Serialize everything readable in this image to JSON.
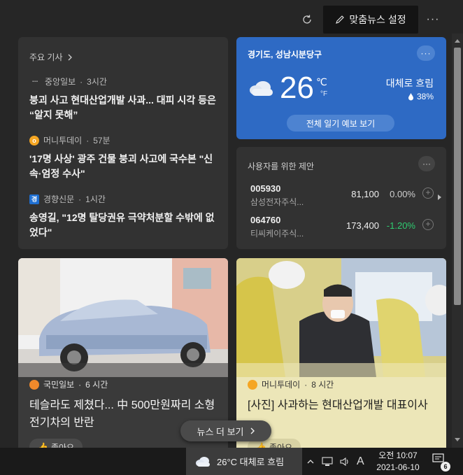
{
  "toolbar": {
    "refresh_icon": "refresh-icon",
    "personalize_label": "맞춤뉴스 설정",
    "more_label": "···"
  },
  "top_stories": {
    "header": "주요 기사",
    "items": [
      {
        "source": "중앙일보",
        "time": "3시간",
        "title": "붕괴 사고 현대산업개발 사과... 대피 시각 등은 “알지 못해”"
      },
      {
        "source": "머니투데이",
        "time": "57분",
        "title": "'17명 사상' 광주 건물 붕괴 사고에 국수본 \"신속·엄정 수사\""
      },
      {
        "source": "경향신문",
        "time": "1시간",
        "title": "송영길, \"12명 탈당권유 극약처분할 수밖에 없었다\""
      }
    ]
  },
  "weather": {
    "location": "경기도, 성남시분당구",
    "temp": "26",
    "unit_c": "℃",
    "unit_f": "°F",
    "condition": "대체로 흐림",
    "precip": "38%",
    "forecast_label": "전체 일기 예보 보기",
    "more_label": "···"
  },
  "stocks": {
    "header": "사용자를 위한 제안",
    "more_label": "···",
    "rows": [
      {
        "code": "005930",
        "name": "삼성전자주식...",
        "price": "81,100",
        "change": "0.00%",
        "change_color": "#cfcfcf"
      },
      {
        "code": "064760",
        "name": "티씨케이주식...",
        "price": "173,400",
        "change": "-1.20%",
        "change_color": "#2ecc71"
      }
    ]
  },
  "news": [
    {
      "source": "국민일보",
      "time": "6 시간",
      "title": "테슬라도 제쳤다... 中 500만원짜리 소형 전기차의 반란",
      "like": "좋아요"
    },
    {
      "source": "머니투데이",
      "time": "8 시간",
      "title": "[사진] 사과하는 현대산업개발 대표이사",
      "like": "좋아요"
    }
  ],
  "see_more": "뉴스 더 보기",
  "taskbar": {
    "weather": "26°C  대체로 흐림",
    "ime": "A",
    "time": "오전 10:07",
    "date": "2021-06-10",
    "notif_count": "6"
  },
  "colors": {
    "weather_bg": "#2e6ac4",
    "accent_positive": "#2ecc71"
  }
}
